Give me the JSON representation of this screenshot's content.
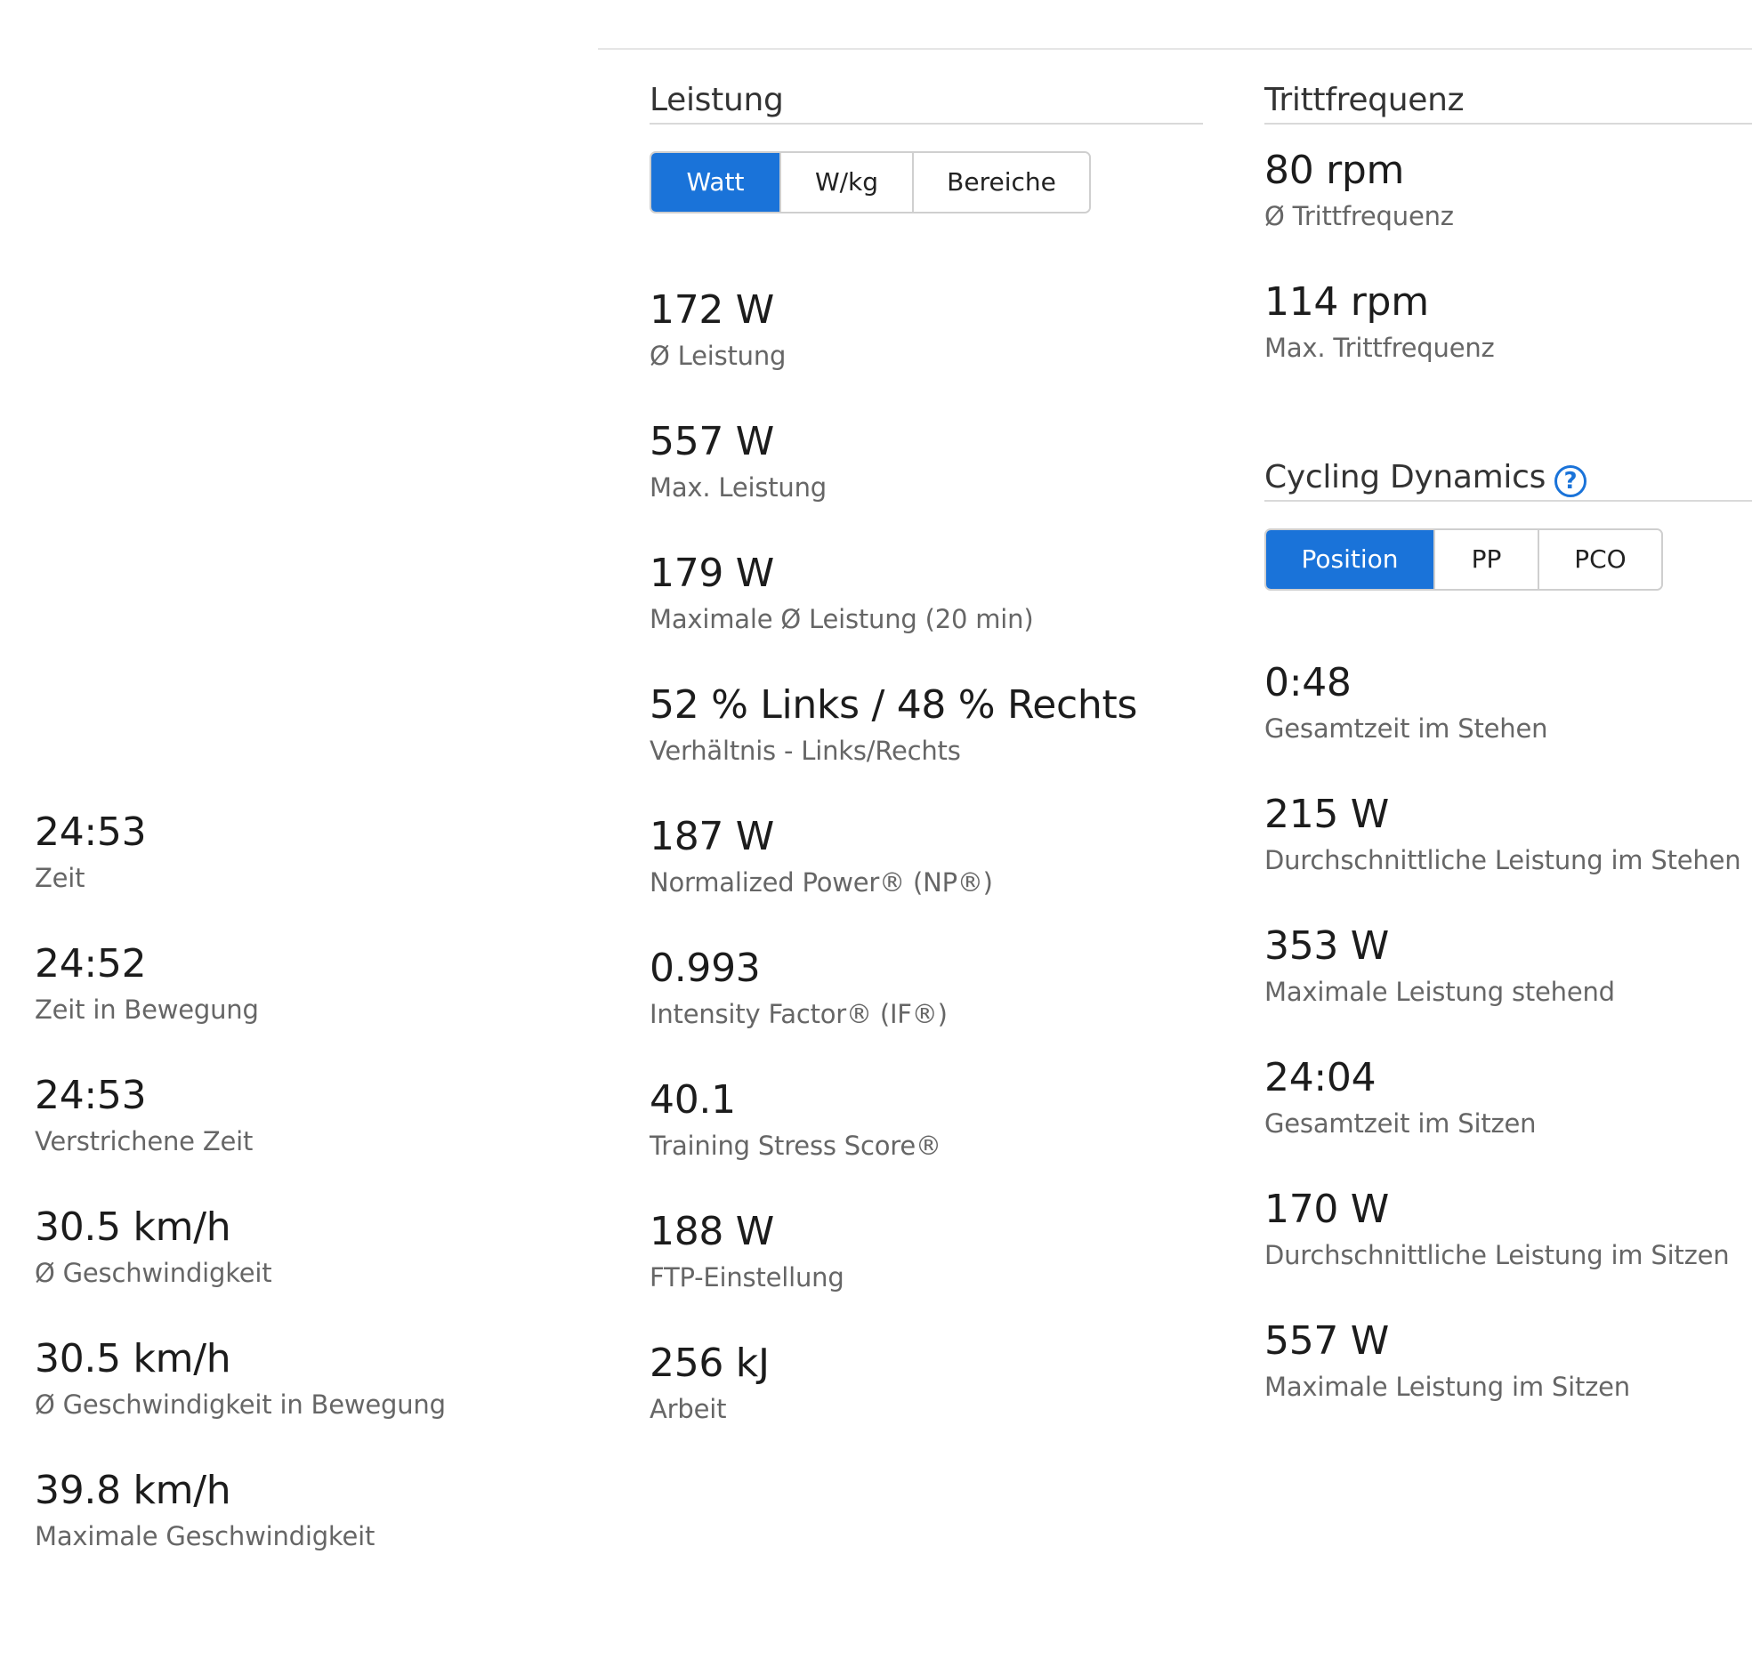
{
  "timing": {
    "stats": [
      {
        "value": "24:53",
        "label": "Zeit"
      },
      {
        "value": "24:52",
        "label": "Zeit in Bewegung"
      },
      {
        "value": "24:53",
        "label": "Verstrichene Zeit"
      },
      {
        "value": "30.5 km/h",
        "label": "Ø Geschwindigkeit"
      },
      {
        "value": "30.5 km/h",
        "label": "Ø Geschwindigkeit in Bewegung"
      },
      {
        "value": "39.8 km/h",
        "label": "Maximale Geschwindigkeit"
      }
    ]
  },
  "power": {
    "title": "Leistung",
    "tabs": [
      {
        "label": "Watt",
        "active": true
      },
      {
        "label": "W/kg",
        "active": false
      },
      {
        "label": "Bereiche",
        "active": false
      }
    ],
    "stats": [
      {
        "value": "172 W",
        "label": "Ø Leistung"
      },
      {
        "value": "557 W",
        "label": "Max. Leistung"
      },
      {
        "value": "179 W",
        "label": "Maximale Ø Leistung (20 min)"
      },
      {
        "value": "52 % Links / 48 % Rechts",
        "label": "Verhältnis - Links/Rechts"
      },
      {
        "value": "187 W",
        "label": "Normalized Power® (NP®)"
      },
      {
        "value": "0.993",
        "label": "Intensity Factor® (IF®)"
      },
      {
        "value": "40.1",
        "label": "Training Stress Score®"
      },
      {
        "value": "188 W",
        "label": "FTP-Einstellung"
      },
      {
        "value": "256 kJ",
        "label": "Arbeit"
      }
    ]
  },
  "cadence": {
    "title": "Trittfrequenz",
    "stats": [
      {
        "value": "80 rpm",
        "label": "Ø Trittfrequenz"
      },
      {
        "value": "114 rpm",
        "label": "Max. Trittfrequenz"
      }
    ]
  },
  "dynamics": {
    "title": "Cycling Dynamics",
    "help_icon": "question-circle-icon",
    "accent_color": "#1a73d9",
    "tabs": [
      {
        "label": "Position",
        "active": true
      },
      {
        "label": "PP",
        "active": false
      },
      {
        "label": "PCO",
        "active": false
      }
    ],
    "stats": [
      {
        "value": "0:48",
        "label": "Gesamtzeit im Stehen"
      },
      {
        "value": "215 W",
        "label": "Durchschnittliche Leistung im Stehen"
      },
      {
        "value": "353 W",
        "label": "Maximale Leistung stehend"
      },
      {
        "value": "24:04",
        "label": "Gesamtzeit im Sitzen"
      },
      {
        "value": "170 W",
        "label": "Durchschnittliche Leistung im Sitzen"
      },
      {
        "value": "557 W",
        "label": "Maximale Leistung im Sitzen"
      }
    ]
  }
}
